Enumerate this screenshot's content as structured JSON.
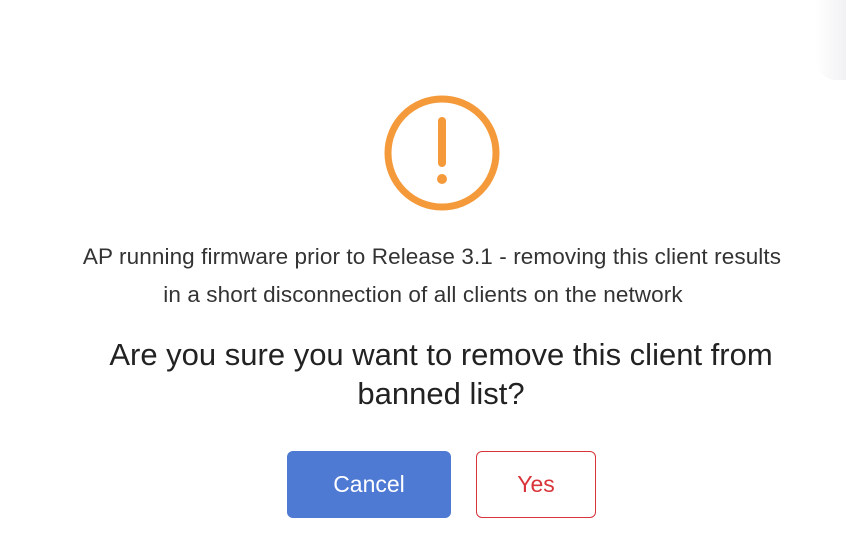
{
  "dialog": {
    "icon": "warning-icon",
    "accent_color": "#f59a3a",
    "info_line1": "AP running firmware prior to Release 3.1 - removing this client results",
    "info_line2": "in a short disconnection of all clients on the network",
    "question_line1": "Are you sure you want to remove this client from",
    "question_line2": "banned list?",
    "cancel_label": "Cancel",
    "yes_label": "Yes",
    "cancel_color": "#4f7ad4",
    "yes_color": "#d9343a"
  }
}
